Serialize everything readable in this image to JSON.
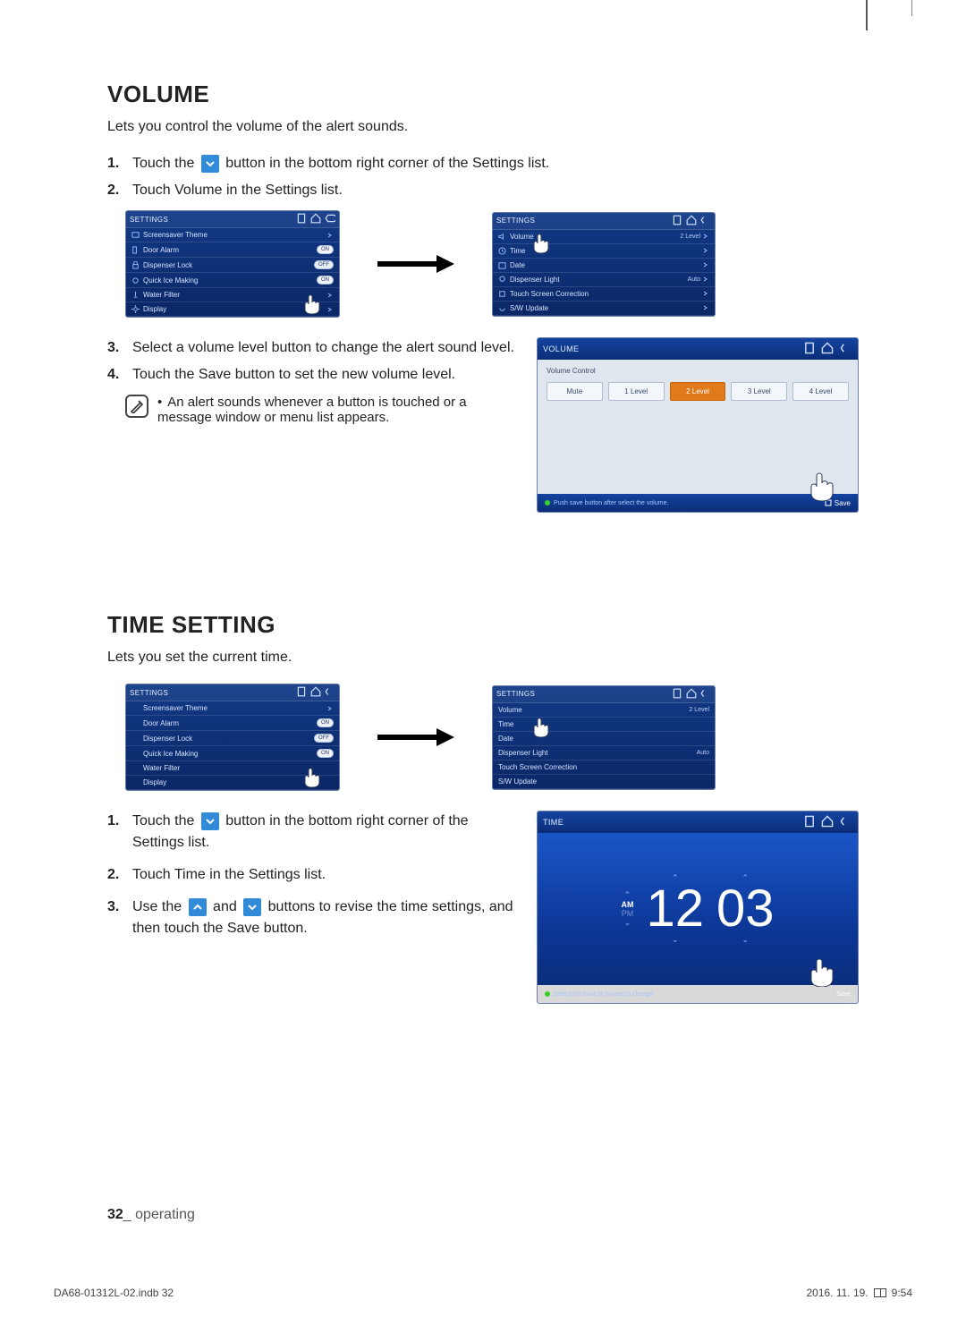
{
  "sections": {
    "volume": {
      "heading": "VOLUME",
      "lead": "Lets you control the volume of the alert sounds.",
      "steps_a": {
        "s1_pre": "Touch the ",
        "s1_post": " button in the bottom right corner of the Settings list.",
        "s2": "Touch Volume in the Settings list."
      },
      "steps_b": {
        "s3": "Select a volume level button to change the alert sound level.",
        "s4": "Touch the Save button to set the new volume level."
      },
      "note": "An alert sounds whenever a button is touched or a message window or menu list appears."
    },
    "time": {
      "heading": "TIME SETTING",
      "lead": "Lets you set the current time.",
      "steps": {
        "s1_pre": "Touch the ",
        "s1_post": " button in the bottom right corner of the Settings list.",
        "s2": "Touch Time in the Settings list.",
        "s3_pre": "Use the ",
        "s3_mid": " and ",
        "s3_post": " buttons to revise the time settings, and then touch the Save button."
      }
    }
  },
  "nums": {
    "n1": "1.",
    "n2": "2.",
    "n3": "3.",
    "n4": "4."
  },
  "settings_thumb": {
    "title": "SETTINGS",
    "rows": [
      {
        "label": "Screensaver Theme",
        "val": "",
        "ic": "image"
      },
      {
        "label": "Door Alarm",
        "val": "ON",
        "ic": "door",
        "toggle": true
      },
      {
        "label": "Dispenser Lock",
        "val": "OFF",
        "ic": "lock",
        "toggle": true
      },
      {
        "label": "Quick Ice Making",
        "val": "ON",
        "ic": "ice",
        "toggle": true
      },
      {
        "label": "Water Filter",
        "val": "",
        "ic": "filter"
      },
      {
        "label": "Display",
        "val": "",
        "ic": "sun"
      }
    ]
  },
  "settings_thumb_right": {
    "title": "SETTINGS",
    "rows": [
      {
        "label": "Volume",
        "val": "2 Level",
        "ic": "speaker"
      },
      {
        "label": "Time",
        "val": "",
        "ic": "clock"
      },
      {
        "label": "Date",
        "val": "",
        "ic": "calendar"
      },
      {
        "label": "Dispenser Light",
        "val": "Auto",
        "ic": "bulb"
      },
      {
        "label": "Touch Screen Correction",
        "val": "",
        "ic": "touch"
      },
      {
        "label": "S/W Update",
        "val": "",
        "ic": "update"
      }
    ]
  },
  "volume_panel": {
    "title": "VOLUME",
    "sub": "Volume Control",
    "buttons": [
      "Mute",
      "1 Level",
      "2 Level",
      "3 Level",
      "4 Level"
    ],
    "selected": 2,
    "tip": "Push save button after select the volume.",
    "save": "Save"
  },
  "time_panel": {
    "title": "TIME",
    "am": "AM",
    "pm": "PM",
    "hour": "12",
    "minute": "03",
    "tip": "Select the hour or minute to change.",
    "save": "Save"
  },
  "footer": {
    "page": "32",
    "section": "_ operating"
  },
  "print": {
    "file": "DA68-01312L-02.indb   32",
    "date": "2016. 11. 19.",
    "time": "9:54"
  }
}
